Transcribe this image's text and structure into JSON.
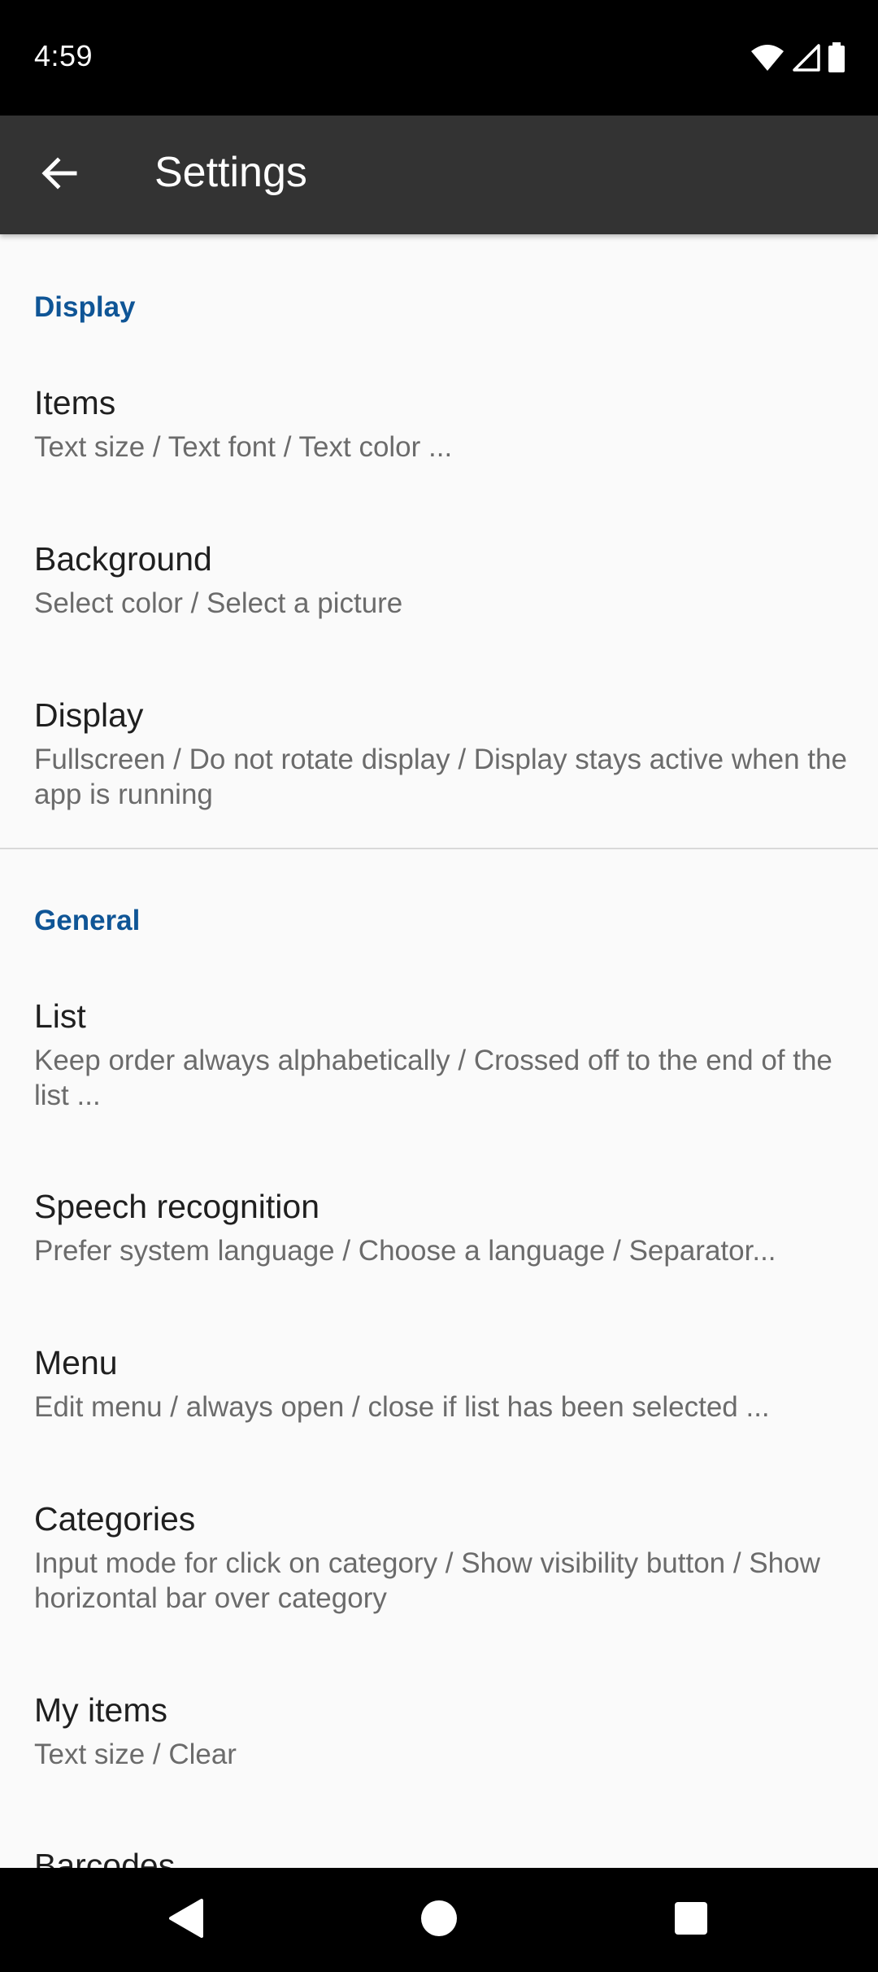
{
  "status_bar": {
    "time": "4:59",
    "icons": [
      "wifi-icon",
      "cell-signal-icon",
      "battery-icon"
    ]
  },
  "app_bar": {
    "title": "Settings",
    "back_icon": "arrow-back-icon"
  },
  "sections": [
    {
      "header": "Display",
      "items": [
        {
          "title": "Items",
          "summary": "Text size / Text font / Text color ..."
        },
        {
          "title": "Background",
          "summary": "Select color / Select a picture"
        },
        {
          "title": "Display",
          "summary": "Fullscreen / Do not rotate display / Display stays active when the app is running"
        }
      ]
    },
    {
      "header": "General",
      "items": [
        {
          "title": "List",
          "summary": "Keep order always alphabetically / Crossed off to the end of the list ..."
        },
        {
          "title": "Speech recognition",
          "summary": "Prefer system language / Choose a language / Separator..."
        },
        {
          "title": "Menu",
          "summary": "Edit menu / always open / close if list has been selected ..."
        },
        {
          "title": "Categories",
          "summary": "Input mode for click on category / Show visibility button / Show horizontal bar over category"
        },
        {
          "title": "My items",
          "summary": "Text size / Clear"
        },
        {
          "title": "Barcodes",
          "summary": ""
        }
      ]
    }
  ],
  "nav_bar": {
    "buttons": [
      "back-triangle-icon",
      "home-circle-icon",
      "recents-square-icon"
    ]
  },
  "colors": {
    "status_bar": "#000000",
    "app_bar": "#333333",
    "accent": "#0f5596",
    "background": "#fafafa"
  }
}
